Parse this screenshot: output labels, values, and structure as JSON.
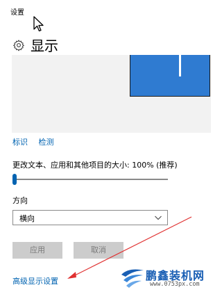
{
  "window": {
    "title": "设置"
  },
  "header": {
    "title": "显示",
    "icon": "gear-icon"
  },
  "preview": {
    "monitor_color": "#2f7bd1",
    "background": "#f2f2f2"
  },
  "links": {
    "identify": "标识",
    "detect": "检测"
  },
  "scale": {
    "label": "更改文本、应用和其他项目的大小: 100% (推荐)",
    "value_percent": 0
  },
  "orientation": {
    "label": "方向",
    "selected": "横向"
  },
  "buttons": {
    "apply": "应用",
    "cancel": "取消"
  },
  "advanced_link": "高级显示设置",
  "watermark": {
    "brand": "鹏鑫装机网",
    "url": "www.0753px.com"
  },
  "colors": {
    "accent": "#0063b1",
    "annotation_arrow": "#e03030"
  }
}
